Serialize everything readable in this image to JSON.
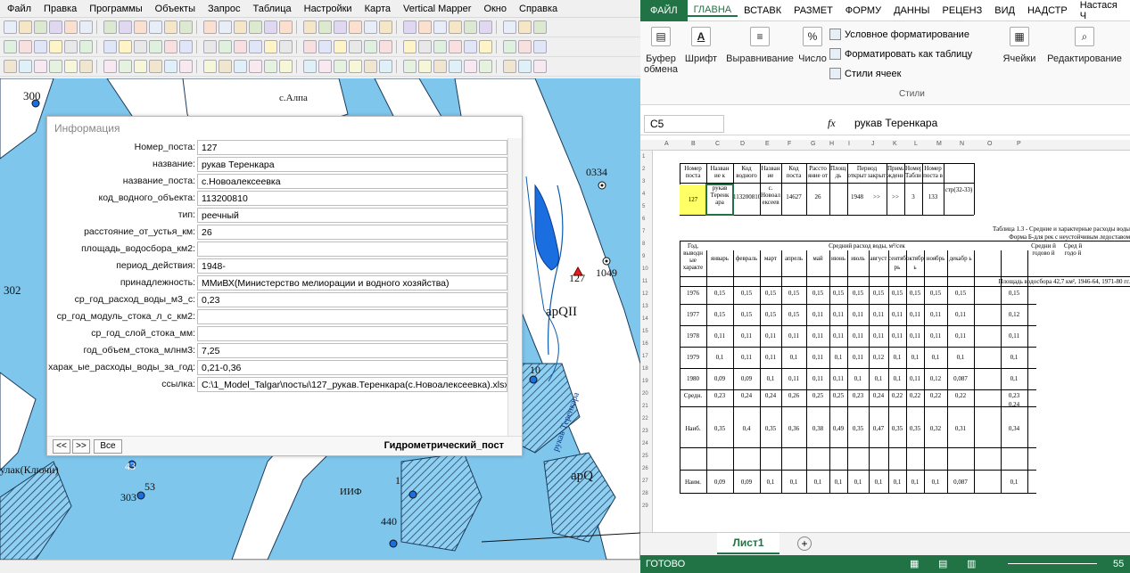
{
  "mapinfo": {
    "menu": [
      "Файл",
      "Правка",
      "Программы",
      "Объекты",
      "Запрос",
      "Таблица",
      "Настройки",
      "Карта",
      "Vertical Mapper",
      "Окно",
      "Справка"
    ],
    "map_labels": {
      "l300": "300",
      "lAlpa": "с.Алпа",
      "l0334": "0334",
      "l1049": "1049",
      "l127": "127",
      "l302": "302",
      "lapQII": "apQII",
      "l10": "10",
      "lapQ": "apQ",
      "lriver": "рукав Теренкара",
      "lKluchi": "улак(Ключи)",
      "l43": "43",
      "l303": "303",
      "l53": "53",
      "l440": "440",
      "lHH": "ИИФ",
      "l1": "1"
    },
    "info": {
      "title": "Информация",
      "fields": [
        {
          "label": "Номер_поста:",
          "value": "127"
        },
        {
          "label": "название:",
          "value": "рукав Теренкара"
        },
        {
          "label": "название_поста:",
          "value": "с.Новоалексеевка"
        },
        {
          "label": "код_водного_объекта:",
          "value": "113200810"
        },
        {
          "label": "тип:",
          "value": "реечный"
        },
        {
          "label": "расстояние_от_устья_км:",
          "value": "26"
        },
        {
          "label": "площадь_водосбора_км2:",
          "value": ""
        },
        {
          "label": "период_действия:",
          "value": "1948-"
        },
        {
          "label": "принадлежность:",
          "value": "ММиВХ(Министерство мелиорации и водного хозяйства)"
        },
        {
          "label": "ср_год_расход_воды_м3_с:",
          "value": "0,23"
        },
        {
          "label": "ср_год_модуль_стока_л_с_км2:",
          "value": ""
        },
        {
          "label": "ср_год_слой_стока_мм:",
          "value": ""
        },
        {
          "label": "год_объем_стока_млнм3:",
          "value": "7,25"
        },
        {
          "label": "харак_ые_расходы_воды_за_год:",
          "value": "0,21-0,36"
        },
        {
          "label": "ссылка:",
          "value": "C:\\1_Model_Talgar\\посты\\127_рукав.Теренкара(с.Новоалексеевка).xlsx"
        }
      ],
      "nav_prev": "<<",
      "nav_next": ">>",
      "nav_all": "Все",
      "layer_name": "Гидрометрический_пост"
    }
  },
  "excel": {
    "tabs": [
      "ФАЙЛ",
      "ГЛАВНА",
      "ВСТАВК",
      "РАЗМЕТ",
      "ФОРМУ",
      "ДАННЫ",
      "РЕЦЕНЗ",
      "ВИД",
      "НАДСТР"
    ],
    "user": "Настася Ч",
    "ribbon": {
      "clipboard": "Буфер",
      "clipboard2": "обмена",
      "font": "Шрифт",
      "align": "Выравнивание",
      "number": "Число",
      "cf": "Условное форматирование",
      "fat": "Форматировать как таблицу",
      "cs": "Стили ячеек",
      "styles": "Стили",
      "cells": "Ячейки",
      "edit": "Редактирование"
    },
    "namebox": "C5",
    "fx": "fx",
    "formula": "рукав Теренкара",
    "cols": [
      "A",
      "B",
      "C",
      "D",
      "E",
      "F",
      "G",
      "H",
      "I",
      "J",
      "K",
      "L",
      "M",
      "N",
      "O",
      "P"
    ],
    "header1": {
      "nomer": "Номер поста",
      "nazv": "Назван ие к",
      "kod": "Код водного",
      "nazv2": "Назван ие",
      "kodp": "Код поста",
      "rast": "Рассто яние от",
      "plosh": "Площа дь",
      "period": "Период",
      "otkr": "открыт",
      "zakr": "закрыт",
      "prim": "Прима ждения",
      "nt": "Номер Таблиц",
      "np": "Номер поста в"
    },
    "row5": {
      "a": "127",
      "b": "рукав Теренк ара",
      "c": "113200810",
      "d": "с. Новоал ексеев",
      "e": "14627",
      "f": "26",
      "g": "1948",
      ">>": ">>",
      "h": ">>",
      "i": "3",
      "j": "133",
      "k": "стр(32-33)"
    },
    "table_title": "Таблица 1.3 - Средние и характерные расходы воды",
    "table_sub": "Форма Б-для рек с неустойчивым ледоставом",
    "col_year": "Год, выводн ые характе",
    "col_mid": "Средний расход воды, м³/сек",
    "col_avg": "Средни й годово й",
    "col_avg2": "Сред й годо й",
    "months": [
      "январь",
      "февраль",
      "март",
      "апрель",
      "май",
      "июнь",
      "июль",
      "август",
      "сентяб рь",
      "октябр ь",
      "ноябрь",
      "декабр ь"
    ],
    "area_note": "Площадь водосбора 42,7 км², 1946-64, 1971-80 гг.",
    "rows": [
      {
        "y": "1976",
        "v": [
          "0,15",
          "0,15",
          "0,15",
          "0,15",
          "0,15",
          "0,15",
          "0,15",
          "0,15",
          "0,15",
          "0,15",
          "0,15",
          "0,15"
        ],
        "a": "0,15"
      },
      {
        "y": "1977",
        "v": [
          "0,15",
          "0,15",
          "0,15",
          "0,15",
          "0,11",
          "0,11",
          "0,11",
          "0,11",
          "0,11",
          "0,11",
          "0,11",
          "0,11"
        ],
        "a": "0,12"
      },
      {
        "y": "1978",
        "v": [
          "0,11",
          "0,11",
          "0,11",
          "0,11",
          "0,11",
          "0,11",
          "0,11",
          "0,11",
          "0,11",
          "0,11",
          "0,11",
          "0,11"
        ],
        "a": "0,11"
      },
      {
        "y": "1979",
        "v": [
          "0,1",
          "0,11",
          "0,11",
          "0,1",
          "0,11",
          "0,1",
          "0,11",
          "0,12",
          "0,1",
          "0,1",
          "0,1",
          "0,1"
        ],
        "a": "0,1"
      },
      {
        "y": "1980",
        "v": [
          "0,09",
          "0,09",
          "0,1",
          "0,11",
          "0,11",
          "0,11",
          "0,1",
          "0,1",
          "0,1",
          "0,11",
          "0,12",
          "0,087"
        ],
        "a": "0,1"
      },
      {
        "y": "Средн.",
        "v": [
          "0,23",
          "0,24",
          "0,24",
          "0,26",
          "0,25",
          "0,25",
          "0,23",
          "0,24",
          "0,22",
          "0,22",
          "0,22",
          "0,22"
        ],
        "a": "0,23"
      }
    ],
    "extra_avg": "0,24",
    "naib": {
      "y": "Наиб.",
      "v": [
        "0,35",
        "0,4",
        "0,35",
        "0,36",
        "0,38",
        "0,49",
        "0,35",
        "0,47",
        "0,35",
        "0,35",
        "0,32",
        "0,31"
      ],
      "a": "0,34"
    },
    "naim": {
      "y": "Наим.",
      "v": [
        "0,09",
        "0,09",
        "0,1",
        "0,1",
        "0,1",
        "0,1",
        "0,1",
        "0,1",
        "0,1",
        "0,1",
        "0,1",
        "0,087"
      ],
      "a": "0,1"
    },
    "sheet_tab": "Лист1",
    "status": "ГОТОВО",
    "zoom": "55"
  }
}
